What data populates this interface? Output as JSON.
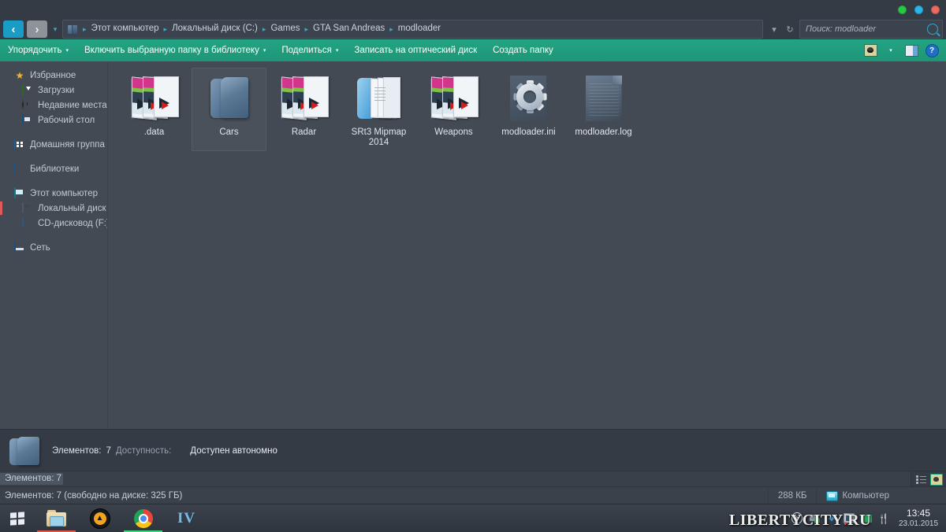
{
  "window": {
    "controls": [
      {
        "name": "minimize",
        "color": "#27c93f"
      },
      {
        "name": "maximize",
        "color": "#29b6e8"
      },
      {
        "name": "close",
        "color": "#ec6a5f"
      }
    ]
  },
  "address_bar": {
    "back_label": "‹",
    "forward_label": "›",
    "history_label": "▾",
    "breadcrumbs": [
      "Этот компьютер",
      "Локальный диск (C:)",
      "Games",
      "GTA San Andreas",
      "modloader"
    ],
    "separator": "▸",
    "dropdown_label": "▾",
    "refresh_label": "↻",
    "search_placeholder": "Поиск: modloader",
    "search_value": ""
  },
  "command_bar": {
    "items": [
      {
        "label": "Упорядочить",
        "caret": true
      },
      {
        "label": "Включить выбранную папку в библиотеку",
        "caret": true
      },
      {
        "label": "Поделиться",
        "caret": true
      },
      {
        "label": "Записать на оптический диск",
        "caret": false
      },
      {
        "label": "Создать папку",
        "caret": false
      }
    ],
    "caret_glyph": "▾",
    "accent_color": "#20a07f"
  },
  "sidebar": {
    "items": [
      {
        "label": "Избранное",
        "icon": "star-icon",
        "level": 0,
        "gap": false,
        "active": false
      },
      {
        "label": "Загрузки",
        "icon": "download-icon",
        "level": 1,
        "gap": false,
        "active": false
      },
      {
        "label": "Недавние места",
        "icon": "clock-icon",
        "level": 1,
        "gap": false,
        "active": false
      },
      {
        "label": "Рабочий стол",
        "icon": "desktop-icon",
        "level": 1,
        "gap": false,
        "active": false
      },
      {
        "label": "Домашняя группа",
        "icon": "homegroup-icon",
        "level": 0,
        "gap": true,
        "active": false
      },
      {
        "label": "Библиотеки",
        "icon": "library-icon",
        "level": 0,
        "gap": true,
        "active": false
      },
      {
        "label": "Этот компьютер",
        "icon": "computer-icon",
        "level": 0,
        "gap": true,
        "active": false
      },
      {
        "label": "Локальный диск (C",
        "icon": "harddrive-icon",
        "level": 1,
        "gap": false,
        "active": true
      },
      {
        "label": "CD-дисковод (F:)",
        "icon": "cd-drive-icon",
        "level": 1,
        "gap": false,
        "active": false
      },
      {
        "label": "Сеть",
        "icon": "network-icon",
        "level": 0,
        "gap": true,
        "active": false
      }
    ]
  },
  "files": [
    {
      "name": ".data",
      "icon": "folder-picture-icon",
      "selected": false
    },
    {
      "name": "Cars",
      "icon": "folder-plain-icon",
      "selected": true
    },
    {
      "name": "Radar",
      "icon": "folder-picture-icon",
      "selected": false
    },
    {
      "name": "SRt3 Mipmap 2014",
      "icon": "folder-book-icon",
      "selected": false
    },
    {
      "name": "Weapons",
      "icon": "folder-picture-icon",
      "selected": false
    },
    {
      "name": "modloader.ini",
      "icon": "gear-file-icon",
      "selected": false
    },
    {
      "name": "modloader.log",
      "icon": "log-file-icon",
      "selected": false
    }
  ],
  "details_pane": {
    "items_key": "Элементов:",
    "items_value": "7",
    "availability_key": "Доступность:",
    "availability_value": "Доступен автономно"
  },
  "scroll_row": {
    "left_label": "Элементов: 7",
    "view_list": "list-view-icon",
    "view_thumb": "thumbnail-view-icon"
  },
  "status_bar": {
    "left": "Элементов: 7 (свободно на диске: 325 ГБ)",
    "size": "288 КБ",
    "location": "Компьютер"
  },
  "taskbar": {
    "start": "windows-start-icon",
    "buttons": [
      {
        "name": "explorer-taskbar-button",
        "icon": "folder-explorer-icon",
        "running": "red"
      },
      {
        "name": "aimp-taskbar-button",
        "icon": "aimp-icon",
        "running": "none"
      },
      {
        "name": "chrome-taskbar-button",
        "icon": "chrome-icon",
        "running": "green"
      },
      {
        "name": "gta-iv-taskbar-button",
        "icon": "gta-iv-icon",
        "label": "IV",
        "running": "none"
      }
    ],
    "tray": [
      "media-play-icon",
      "network-icon",
      "bluetooth-icon",
      "screen-icon",
      "flag-icon",
      "utility-icon"
    ],
    "clock_time": "13:45",
    "clock_date": "23.01.2015"
  },
  "watermark": {
    "text_a": "LIBERTYCITY",
    "dot": ".",
    "text_b": "RU"
  }
}
